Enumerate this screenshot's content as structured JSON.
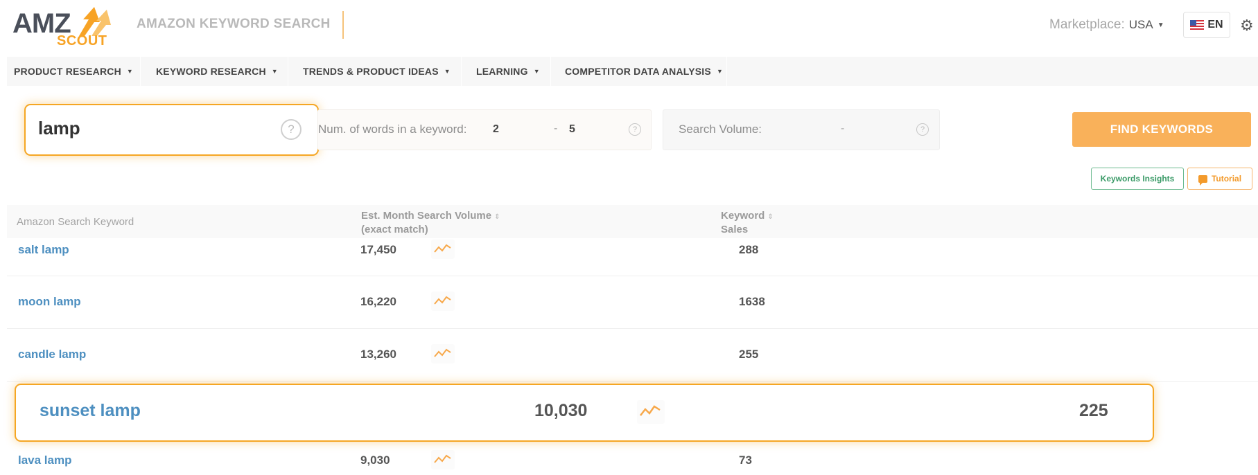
{
  "header": {
    "logo_top": "AMZ",
    "logo_bottom": "SCOUT",
    "app_title": "AMAZON KEYWORD SEARCH",
    "marketplace_label": "Marketplace:",
    "marketplace_value": "USA",
    "language": "EN",
    "settings_icon": "gear-icon"
  },
  "nav": {
    "items": [
      {
        "label": "PRODUCT RESEARCH"
      },
      {
        "label": "KEYWORD RESEARCH"
      },
      {
        "label": "TRENDS & PRODUCT IDEAS"
      },
      {
        "label": "LEARNING"
      },
      {
        "label": "COMPETITOR DATA ANALYSIS"
      }
    ]
  },
  "search": {
    "keyword": "lamp",
    "words_label": "Num. of words in a keyword:",
    "words_min": "2",
    "words_max": "5",
    "volume_label": "Search Volume:",
    "range_separator": "-",
    "find_button": "FIND KEYWORDS"
  },
  "actions": {
    "insights": "Keywords Insights",
    "tutorial": "Tutorial"
  },
  "table": {
    "columns": {
      "keyword": "Amazon Search Keyword",
      "volume_line1": "Est. Month Search Volume",
      "volume_line2": "(exact match)",
      "sales_line1": "Keyword",
      "sales_line2": "Sales"
    },
    "rows": [
      {
        "keyword": "salt lamp",
        "volume": "17,450",
        "sales": "288"
      },
      {
        "keyword": "moon lamp",
        "volume": "16,220",
        "sales": "1638"
      },
      {
        "keyword": "candle lamp",
        "volume": "13,260",
        "sales": "255"
      },
      {
        "keyword": "sunset lamp",
        "volume": "10,030",
        "sales": "225",
        "highlighted": true
      },
      {
        "keyword": "lava lamp",
        "volume": "9,030",
        "sales": "73"
      }
    ]
  },
  "colors": {
    "accent": "#f5a623",
    "link": "#4d8fc0",
    "insights": "#3a9a67"
  }
}
